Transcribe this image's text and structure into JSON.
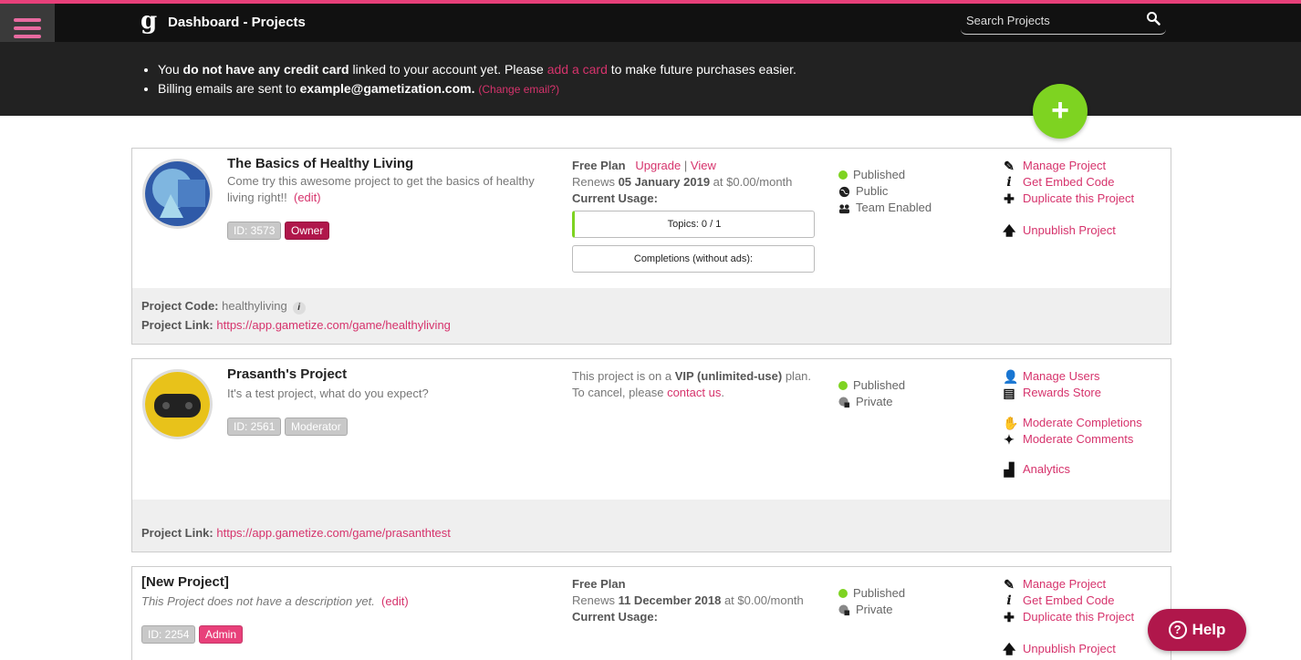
{
  "header": {
    "title": "Dashboard - Projects",
    "logo_text": "g",
    "search_placeholder": "Search Projects"
  },
  "notice": {
    "line1_pre": "You ",
    "line1_bold": "do not have any credit card",
    "line1_mid": " linked to your account yet. Please ",
    "line1_link": "add a card",
    "line1_post": " to make future purchases easier.",
    "line2_pre": "Billing emails are sent to ",
    "line2_email": "example@gametization.com.",
    "line2_link": "(Change email?)"
  },
  "add_button_label": "+",
  "projects": [
    {
      "title": "The Basics of Healthy Living",
      "description": "Come try this awesome project to get the basics of healthy living right!!",
      "edit_label": "(edit)",
      "id_label": "ID: 3573",
      "role": "Owner",
      "plan_name": "Free Plan",
      "upgrade": "Upgrade",
      "separator": "|",
      "view": "View",
      "renews_pre": "Renews ",
      "renews_date": "05 January 2019",
      "renews_post": " at $0.00/month",
      "usage_label": "Current Usage:",
      "topics": "Topics: 0 / 1",
      "completions": "Completions (without ads):",
      "status": [
        "Published",
        "Public",
        "Team Enabled"
      ],
      "actions": [
        "Manage Project",
        "Get Embed Code",
        "Duplicate this Project",
        "Unpublish Project"
      ],
      "code_label": "Project Code:",
      "code_value": "healthyliving",
      "link_label": "Project Link:",
      "link_value": "https://app.gametize.com/game/healthyliving"
    },
    {
      "title": "Prasanth's Project",
      "description": "It's a test project, what do you expect?",
      "id_label": "ID: 2561",
      "role": "Moderator",
      "plan_pre": "This project is on a ",
      "plan_bold": "VIP (unlimited-use)",
      "plan_post": " plan.",
      "cancel_pre": "To cancel, please ",
      "cancel_link": "contact us",
      "cancel_post": ".",
      "status": [
        "Published",
        "Private"
      ],
      "actions": [
        "Manage Users",
        "Rewards Store",
        "Moderate Completions",
        "Moderate Comments",
        "Analytics"
      ],
      "link_label": "Project Link:",
      "link_value": "https://app.gametize.com/game/prasanthtest"
    },
    {
      "title": "[New Project]",
      "description": "This Project does not have a description yet.",
      "edit_label": "(edit)",
      "id_label": "ID: 2254",
      "role": "Admin",
      "plan_name": "Free Plan",
      "renews_pre": "Renews ",
      "renews_date": "11 December 2018",
      "renews_post": " at $0.00/month",
      "usage_label": "Current Usage:",
      "status": [
        "Published",
        "Private"
      ],
      "actions": [
        "Manage Project",
        "Get Embed Code",
        "Duplicate this Project",
        "Unpublish Project"
      ]
    }
  ],
  "help_label": "Help",
  "colors": {
    "accent": "#e8407a",
    "link": "#d6336c",
    "success": "#7ed321",
    "dark_badge": "#b0174b"
  }
}
